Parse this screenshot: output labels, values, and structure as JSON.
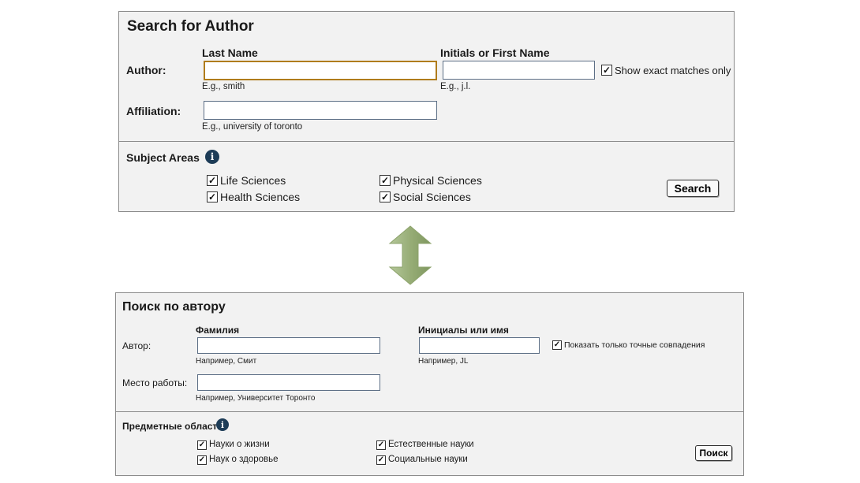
{
  "en": {
    "title": "Search for Author",
    "author_label": "Author:",
    "last_name_header": "Last Name",
    "first_name_header": "Initials or First Name",
    "last_name_value": "",
    "first_name_value": "",
    "last_name_hint": "E.g., smith",
    "first_name_hint": "E.g., j.l.",
    "exact_label": "Show exact matches only",
    "exact_checked": true,
    "affiliation_label": "Affiliation:",
    "affiliation_value": "",
    "affiliation_hint": "E.g., university of toronto",
    "subject_label": "Subject Areas",
    "subjects": [
      "Life Sciences",
      "Physical Sciences",
      "Health Sciences",
      "Social Sciences"
    ],
    "search_button": "Search"
  },
  "ru": {
    "title": "Поиск по автору",
    "author_label": "Автор:",
    "last_name_header": "Фамилия",
    "first_name_header": "Инициалы или имя",
    "last_name_value": "",
    "first_name_value": "",
    "last_name_hint": "Например, Смит",
    "first_name_hint": "Например, JL",
    "exact_label": "Показать только точные совпадения",
    "exact_checked": true,
    "affiliation_label": "Место работы:",
    "affiliation_value": "",
    "affiliation_hint": "Например, Университет Торонто",
    "subject_label": "Предметные области",
    "subjects": [
      "Науки о жизни",
      "Естественные науки",
      "Наук о здоровье",
      "Социальные науки"
    ],
    "search_button": "Поиск"
  },
  "icons": {
    "info": "info-icon",
    "check": "checkmark-icon",
    "arrow": "double-arrow-icon"
  },
  "colors": {
    "arrow": "#97ad76",
    "info": "#1d3c57",
    "focus_border": "#b07c1c"
  },
  "glyphs": {
    "check": "✓",
    "info": "i"
  }
}
